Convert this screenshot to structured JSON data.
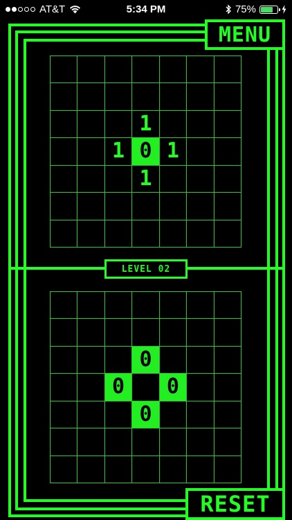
{
  "status_bar": {
    "carrier": "AT&T",
    "time": "5:34 PM",
    "battery_percent": "75%",
    "battery_level": 0.75,
    "signal_bars_filled": 2,
    "signal_bars_total": 5
  },
  "colors": {
    "accent": "#22ff22",
    "background": "#000000"
  },
  "menu_button": {
    "label": "MENU"
  },
  "reset_button": {
    "label": "RESET"
  },
  "level_label": {
    "text": "LEVEL 02"
  },
  "target_grid": {
    "size": 7,
    "cells": [
      [
        "",
        "",
        "",
        "",
        "",
        "",
        ""
      ],
      [
        "",
        "",
        "",
        "",
        "",
        "",
        ""
      ],
      [
        "",
        "",
        "",
        "1",
        "",
        "",
        ""
      ],
      [
        "",
        "",
        "1",
        "0",
        "1",
        "",
        ""
      ],
      [
        "",
        "",
        "",
        "1",
        "",
        "",
        ""
      ],
      [
        "",
        "",
        "",
        "",
        "",
        "",
        ""
      ],
      [
        "",
        "",
        "",
        "",
        "",
        "",
        ""
      ]
    ],
    "filled": [
      [
        3,
        3
      ]
    ]
  },
  "player_grid": {
    "size": 7,
    "cells": [
      [
        "",
        "",
        "",
        "",
        "",
        "",
        ""
      ],
      [
        "",
        "",
        "",
        "",
        "",
        "",
        ""
      ],
      [
        "",
        "",
        "",
        "0",
        "",
        "",
        ""
      ],
      [
        "",
        "",
        "0",
        "",
        "0",
        "",
        ""
      ],
      [
        "",
        "",
        "",
        "0",
        "",
        "",
        ""
      ],
      [
        "",
        "",
        "",
        "",
        "",
        "",
        ""
      ],
      [
        "",
        "",
        "",
        "",
        "",
        "",
        ""
      ]
    ],
    "filled": [
      [
        2,
        3
      ],
      [
        3,
        2
      ],
      [
        3,
        4
      ],
      [
        4,
        3
      ]
    ]
  }
}
